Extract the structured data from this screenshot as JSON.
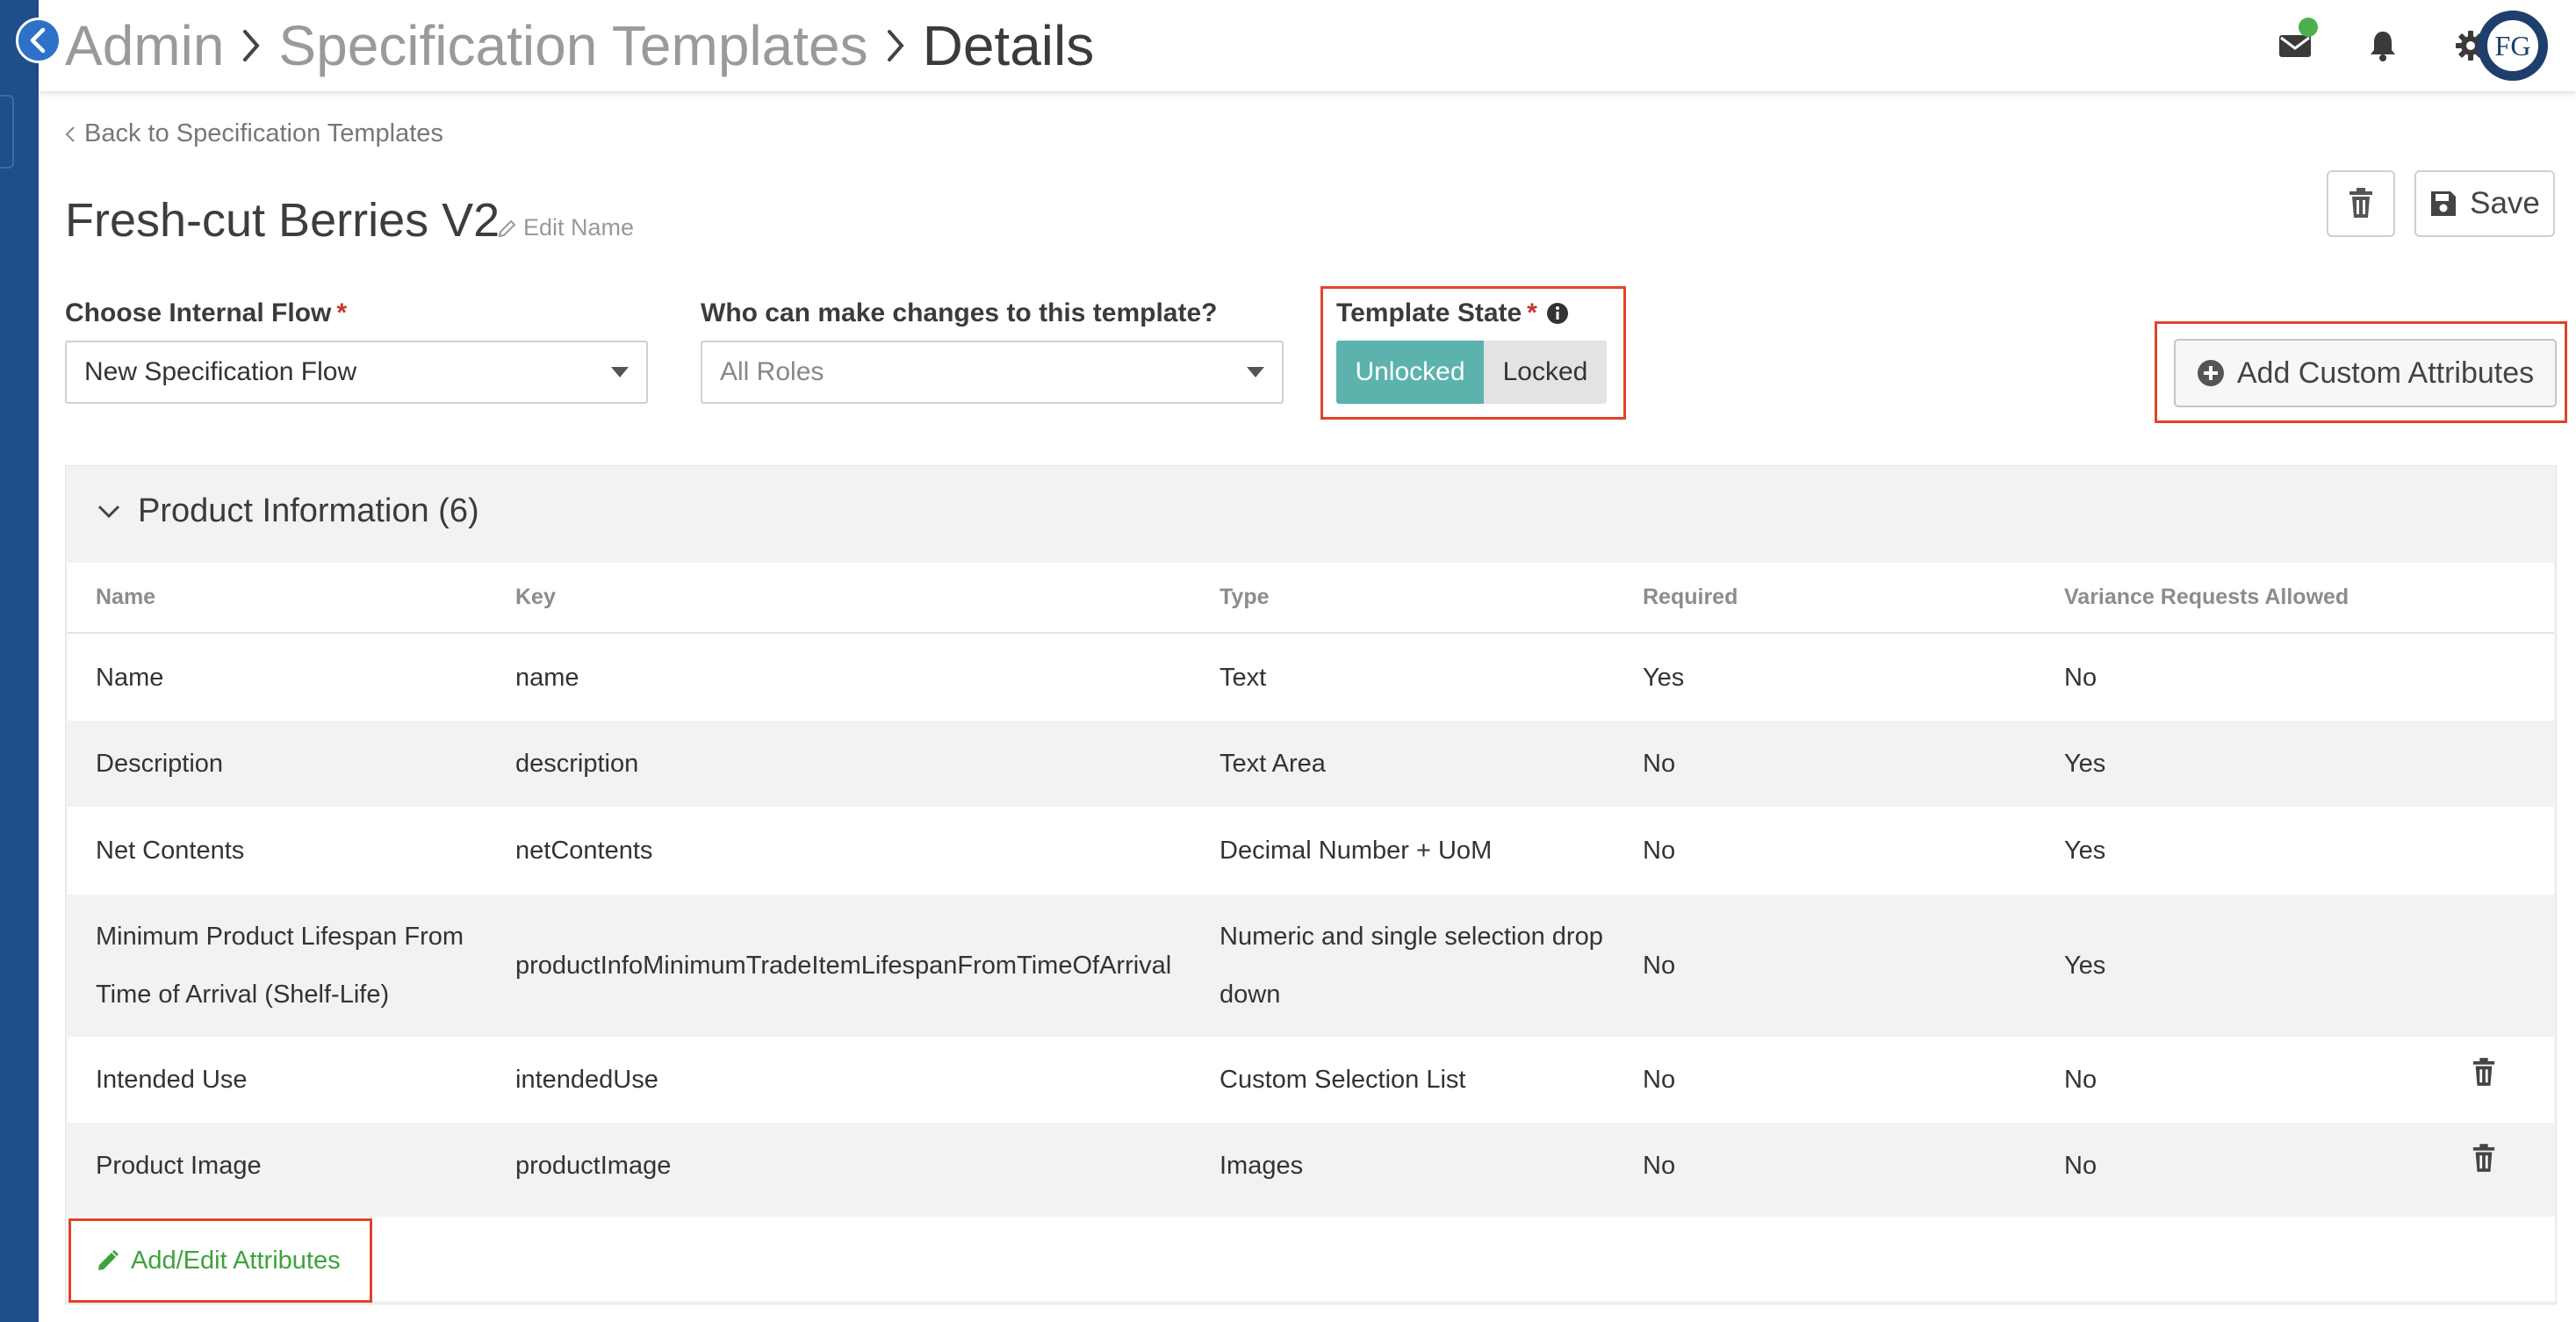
{
  "breadcrumb": {
    "items": [
      "Admin",
      "Specification Templates"
    ],
    "current": "Details"
  },
  "nav": {
    "back_label": "Back to Specification Templates"
  },
  "header": {
    "avatar_initials": "FG"
  },
  "template": {
    "title": "Fresh-cut Berries V2",
    "edit_name_label": "Edit Name"
  },
  "actions": {
    "save_label": "Save",
    "add_custom_label": "Add Custom Attributes"
  },
  "form": {
    "flow_label": "Choose Internal Flow",
    "flow_value": "New Specification Flow",
    "roles_label": "Who can make changes to this template?",
    "roles_value": "All Roles",
    "state_label": "Template State",
    "state_options": [
      "Unlocked",
      "Locked"
    ],
    "state_selected": "Unlocked",
    "required_mark": "*"
  },
  "section": {
    "title": "Product Information (6)",
    "columns": [
      "Name",
      "Key",
      "Type",
      "Required",
      "Variance Requests Allowed"
    ],
    "rows": [
      {
        "name": "Name",
        "key": "name",
        "type": "Text",
        "required": "Yes",
        "variance": "No"
      },
      {
        "name": "Description",
        "key": "description",
        "type": "Text Area",
        "required": "No",
        "variance": "Yes"
      },
      {
        "name": "Net Contents",
        "key": "netContents",
        "type": "Decimal Number + UoM",
        "required": "No",
        "variance": "Yes"
      },
      {
        "name": "Minimum Product Lifespan From Time of Arrival (Shelf-Life)",
        "key": "productInfoMinimumTradeItemLifespanFromTimeOfArrival",
        "type": "Numeric and single selection drop down",
        "required": "No",
        "variance": "Yes"
      },
      {
        "name": "Intended Use",
        "key": "intendedUse",
        "type": "Custom Selection List",
        "required": "No",
        "variance": "No"
      },
      {
        "name": "Product Image",
        "key": "productImage",
        "type": "Images",
        "required": "No",
        "variance": "No"
      }
    ],
    "add_edit_label": "Add/Edit Attributes"
  },
  "colors": {
    "accent_teal": "#5cb3ad",
    "highlight_red": "#e0442a",
    "link_green": "#3ca33c",
    "nav_blue": "#1f4e8c"
  }
}
